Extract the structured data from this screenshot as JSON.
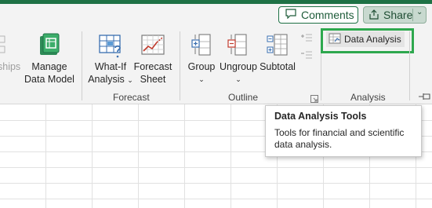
{
  "header": {
    "comments_label": "Comments",
    "share_label": "Share"
  },
  "ribbon": {
    "partial_label": "ships",
    "manage_data_model": {
      "line1": "Manage",
      "line2": "Data Model"
    },
    "what_if": {
      "line1": "What-If",
      "line2": "Analysis"
    },
    "forecast_sheet": {
      "line1": "Forecast",
      "line2": "Sheet"
    },
    "group_label": "Group",
    "ungroup_label": "Ungroup",
    "subtotal_label": "Subtotal",
    "data_analysis_label": "Data Analysis",
    "groups": {
      "forecast": "Forecast",
      "outline": "Outline",
      "analysis": "Analysis"
    }
  },
  "tooltip": {
    "title": "Data Analysis Tools",
    "body": "Tools for financial and scientific data analysis."
  },
  "colors": {
    "excel_green": "#1e7145",
    "highlight_green": "#2ea84e"
  }
}
